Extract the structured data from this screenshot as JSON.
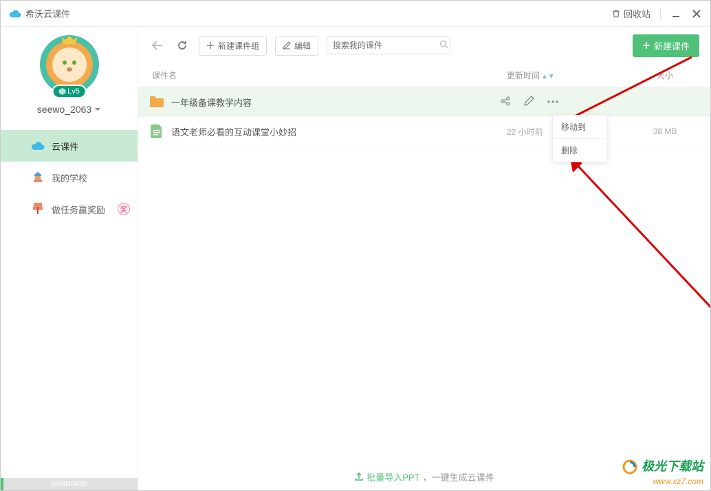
{
  "titlebar": {
    "app_name": "希沃云课件",
    "recycle": "回收站"
  },
  "sidebar": {
    "username": "seewo_2063",
    "level": "Lv5",
    "nav": [
      {
        "label": "云课件"
      },
      {
        "label": "我的学校"
      },
      {
        "label": "做任务赢奖励",
        "badge": "奖"
      }
    ],
    "storage": "38MB/4GB"
  },
  "toolbar": {
    "new_group": "新建课件组",
    "edit": "编辑",
    "search_placeholder": "搜索我的课件",
    "create": "新建课件"
  },
  "columns": {
    "name": "课件名",
    "time": "更新时间",
    "size": "大小"
  },
  "rows": [
    {
      "name": "一年级备课教学内容",
      "time": "",
      "size": ""
    },
    {
      "name": "语文老师必看的互动课堂小妙招",
      "time": "22 小时前",
      "size": "38 MB"
    }
  ],
  "dropdown": {
    "move": "移动到",
    "delete": "删除"
  },
  "footer": {
    "import": "批量导入PPT",
    "tail": "，一键生成云课件"
  },
  "watermark": {
    "cn": "极光下载站",
    "en": "www.xz7.com"
  },
  "colors": {
    "accent": "#4fc179"
  }
}
